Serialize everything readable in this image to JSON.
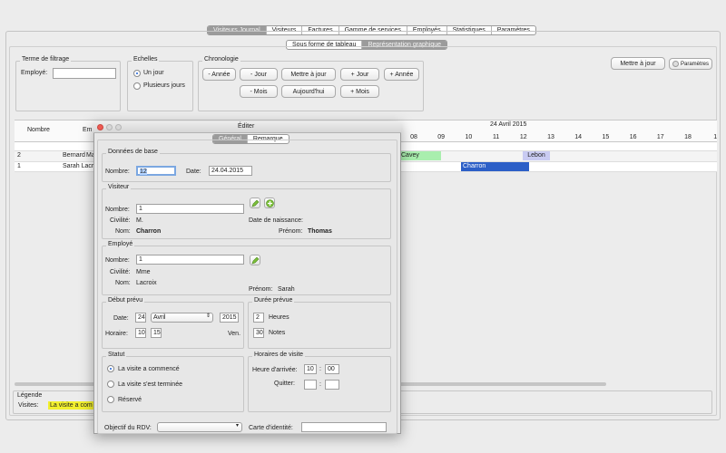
{
  "top_tabs": [
    {
      "label": "Visiteurs Journal",
      "selected": true
    },
    {
      "label": "Visiteurs",
      "selected": false
    },
    {
      "label": "Factures",
      "selected": false
    },
    {
      "label": "Gamme de services",
      "selected": false
    },
    {
      "label": "Employés",
      "selected": false
    },
    {
      "label": "Statistiques",
      "selected": false
    },
    {
      "label": "Paramètres",
      "selected": false
    }
  ],
  "sub_tabs": [
    {
      "label": "Sous forme de tableau",
      "selected": false
    },
    {
      "label": "Représentation graphique",
      "selected": true
    }
  ],
  "filter": {
    "title": "Terme de filtrage",
    "employee_label": "Employé:",
    "employee_value": ""
  },
  "scales": {
    "title": "Echelles",
    "one_day": "Un jour",
    "several_days": "Plusieurs jours"
  },
  "chronology": {
    "title": "Chronologie",
    "minus_year": "- Année",
    "minus_day": "- Jour",
    "update_to_day": "Mettre à jour",
    "plus_day": "+ Jour",
    "plus_year": "+ Année",
    "minus_month": "- Mois",
    "today": "Aujourd'hui",
    "plus_month": "+ Mois"
  },
  "right_buttons": {
    "update": "Mettre à jour",
    "settings": "Paramètres"
  },
  "schedule": {
    "date": "24 Avril 2015",
    "col_number": "Nombre",
    "col_employee": "Em",
    "hours": [
      "08",
      "09",
      "10",
      "11",
      "12",
      "13",
      "14",
      "15",
      "16",
      "17",
      "18",
      "1"
    ],
    "rows": [
      {
        "number": "2",
        "employee": "Bernard",
        "employee_tail": "Ma"
      },
      {
        "number": "1",
        "employee": "Sarah Lacro",
        "employee_tail": ""
      }
    ],
    "events": [
      {
        "label": "Cavey",
        "color": "#a9eeae"
      },
      {
        "label": "Lebon",
        "color": "#c9cbf2"
      },
      {
        "label": "Charron",
        "color": "#2c5fc7"
      }
    ]
  },
  "legend": {
    "title": "Légende",
    "visits_label": "Visites:",
    "visit_started": "La visite a com"
  },
  "dialog": {
    "title": "Éditer",
    "tabs": [
      {
        "label": "Général",
        "selected": true
      },
      {
        "label": "Remarque",
        "selected": false
      }
    ],
    "base": {
      "title": "Données de base",
      "number_label": "Nombre:",
      "number_value": "12",
      "date_label": "Date:",
      "date_value": "24.04.2015"
    },
    "visitor": {
      "title": "Visiteur",
      "number_label": "Nombre:",
      "number_value": "1",
      "civility_label": "Civilité:",
      "civility_value": "M.",
      "name_label": "Nom:",
      "name_value": "Charron",
      "birth_label": "Date de naissance:",
      "firstname_label": "Prénom:",
      "firstname_value": "Thomas"
    },
    "employee": {
      "title": "Employé",
      "number_label": "Nombre:",
      "number_value": "1",
      "civility_label": "Civilité:",
      "civility_value": "Mme",
      "name_label": "Nom:",
      "name_value": "Lacroix",
      "firstname_label": "Prénom:",
      "firstname_value": "Sarah"
    },
    "start": {
      "title": "Début prévu",
      "date_label": "Date:",
      "day": "24",
      "month": "Avril",
      "year": "2015",
      "time_label": "Horaire:",
      "hour": "10",
      "minute": "15",
      "weekday": "Ven."
    },
    "duration": {
      "title": "Durée prévue",
      "hours_value": "2",
      "hours_label": "Heures",
      "notes_value": "30",
      "notes_label": "Notes"
    },
    "status": {
      "title": "Statut",
      "started": "La visite a commencé",
      "finished": "La visite s'est terminée",
      "reserved": "Réservé"
    },
    "visit_times": {
      "title": "Horaires de visite",
      "arrival_label": "Heure d'arrivée:",
      "arrival_hour": "10",
      "arrival_minute": "00",
      "leave_label": "Quitter:",
      "sep": ":"
    },
    "bottom": {
      "purpose_label": "Objectif du RDV:",
      "id_card_label": "Carte d'identité:"
    }
  }
}
